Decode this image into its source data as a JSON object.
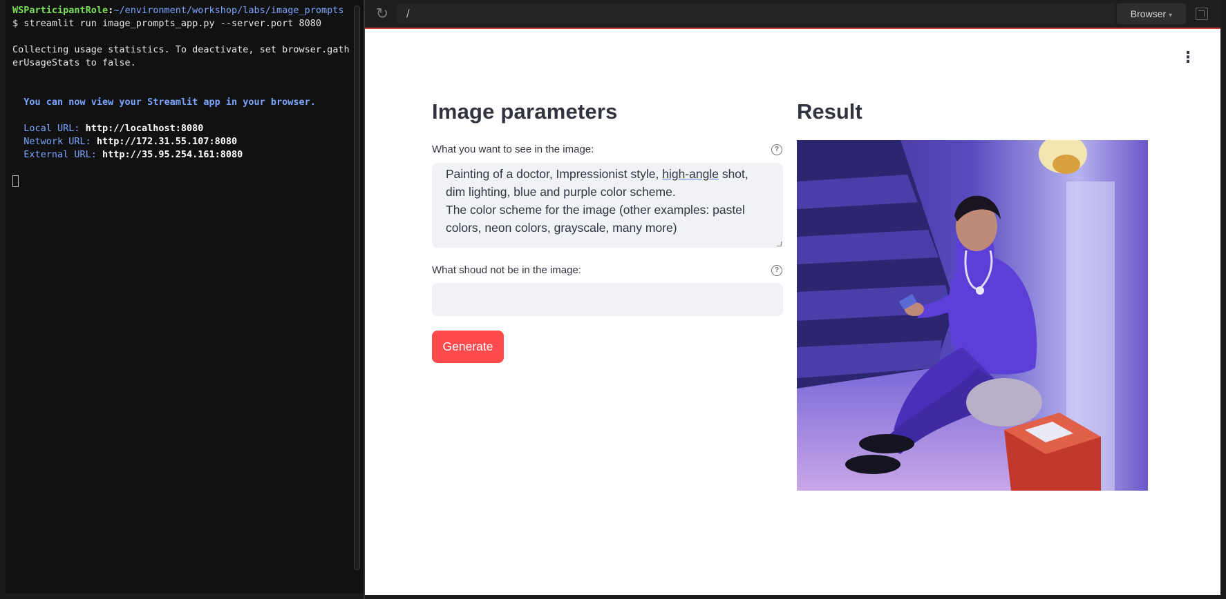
{
  "terminal": {
    "prompt_user": "WSParticipantRole",
    "prompt_sep": ":",
    "prompt_path": "~/environment/workshop/labs/image_prompts",
    "command": "$ streamlit run image_prompts_app.py --server.port 8080",
    "usage_line1": "Collecting usage statistics. To deactivate, set browser.gath",
    "usage_line2": "erUsageStats to false.",
    "view_message": "  You can now view your Streamlit app in your browser.",
    "local_label": "  Local URL: ",
    "local_url": "http://localhost:8080",
    "network_label": "  Network URL: ",
    "network_url": "http://172.31.55.107:8080",
    "external_label": "  External URL: ",
    "external_url": "http://35.95.254.161:8080"
  },
  "browser": {
    "url": "/",
    "browser_button": "Browser"
  },
  "app": {
    "params_title": "Image parameters",
    "result_title": "Result",
    "prompt_label": "What you want to see in the image:",
    "prompt_value_a": "Painting of a doctor, Impressionist style, ",
    "prompt_value_underlined": "high-angle",
    "prompt_value_b": " shot,\ndim lighting, blue and purple color scheme.\nThe color scheme for the image (other examples: pastel\ncolors, neon colors, grayscale, many more)",
    "negative_label": "What shoud not be in the image:",
    "negative_value": "",
    "generate_label": "Generate",
    "help_glyph": "?"
  },
  "colors": {
    "accent": "#ff4b4b",
    "text": "#31333f",
    "input_bg": "#f0f2f6"
  }
}
